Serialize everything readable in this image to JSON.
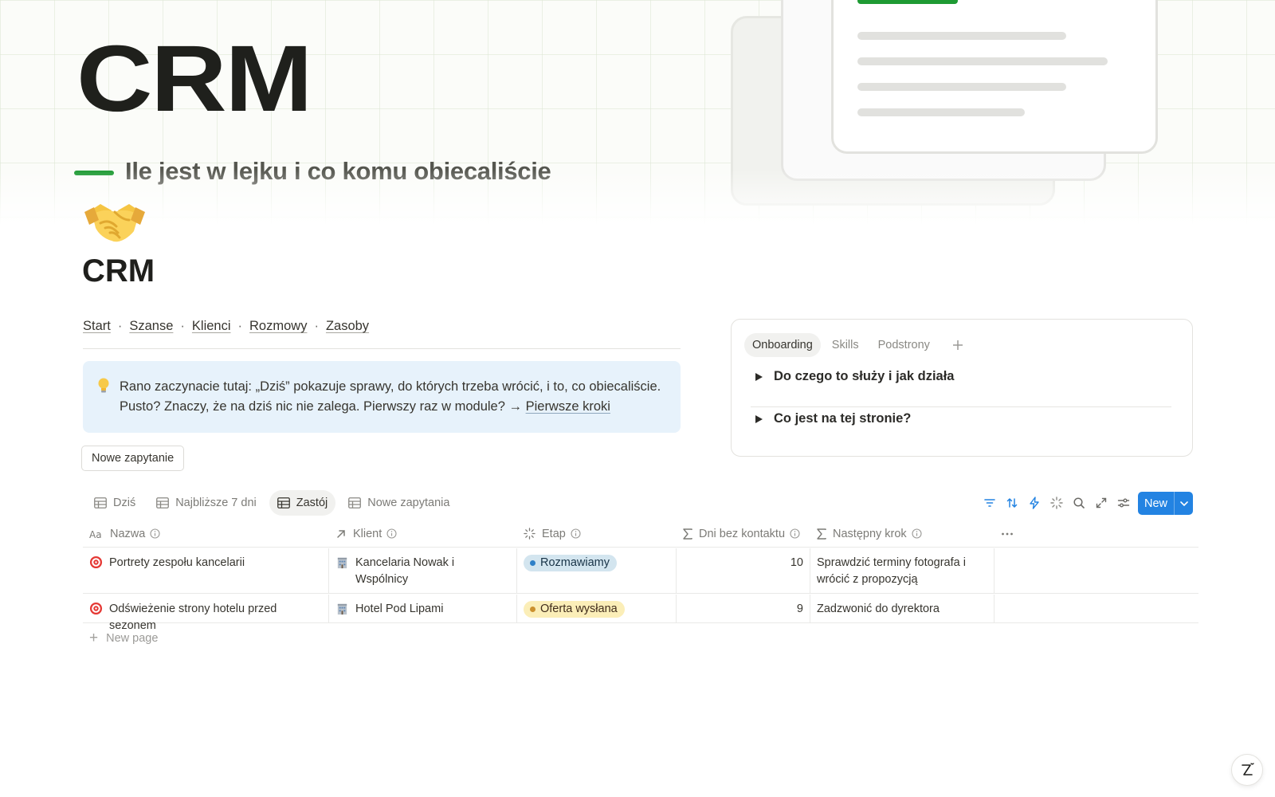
{
  "cover": {
    "title": "CRM",
    "subtitle": "Ile jest w lejku i co komu obiecaliście",
    "accent_color": "#1e9a33"
  },
  "page": {
    "icon": "handshake-icon",
    "title": "CRM"
  },
  "nav": {
    "items": [
      "Start",
      "Szanse",
      "Klienci",
      "Rozmowy",
      "Zasoby"
    ],
    "separator": "·"
  },
  "callout": {
    "icon": "lightbulb-icon",
    "line1": "Rano zaczynacie tutaj: „Dziś” pokazuje sprawy, do których trzeba wrócić, i to, co obiecaliście.",
    "line2_prefix": "Pusto? Znaczy, że na dziś nic nie zalega. Pierwszy raz w module? →",
    "link": "Pierwsze kroki",
    "bg_color": "#e7f2fb"
  },
  "buttons": {
    "new_inquiry": "Nowe zapytanie",
    "new": "New"
  },
  "panel": {
    "tabs": [
      "Onboarding",
      "Skills",
      "Podstrony"
    ],
    "active_tab": "Onboarding",
    "toggles": [
      "Do czego to służy i jak działa",
      "Co jest na tej stronie?"
    ]
  },
  "views": {
    "tabs": [
      "Dziś",
      "Najbliższe 7 dni",
      "Zastój",
      "Nowe zapytania"
    ],
    "active": "Zastój"
  },
  "table": {
    "columns": [
      "Nazwa",
      "Klient",
      "Etap",
      "Dni bez kontaktu",
      "Następny krok"
    ],
    "rows": [
      {
        "name": "Portrety zespołu kancelarii",
        "client": "Kancelaria Nowak i Wspólnicy",
        "stage": "Rozmawiamy",
        "stage_color": "blue",
        "days": "10",
        "next_step": "Sprawdzić terminy fotografa i wrócić z propozycją"
      },
      {
        "name": "Odświeżenie strony hotelu przed sezonem",
        "client": "Hotel Pod Lipami",
        "stage": "Oferta wysłana",
        "stage_color": "yellow",
        "days": "9",
        "next_step": "Zadzwonić do dyrektora"
      }
    ],
    "new_page": "New page"
  },
  "colors": {
    "primary_button": "#2383e2",
    "tag_blue": "#d3e5ef",
    "tag_yellow": "#fbeeb8"
  }
}
